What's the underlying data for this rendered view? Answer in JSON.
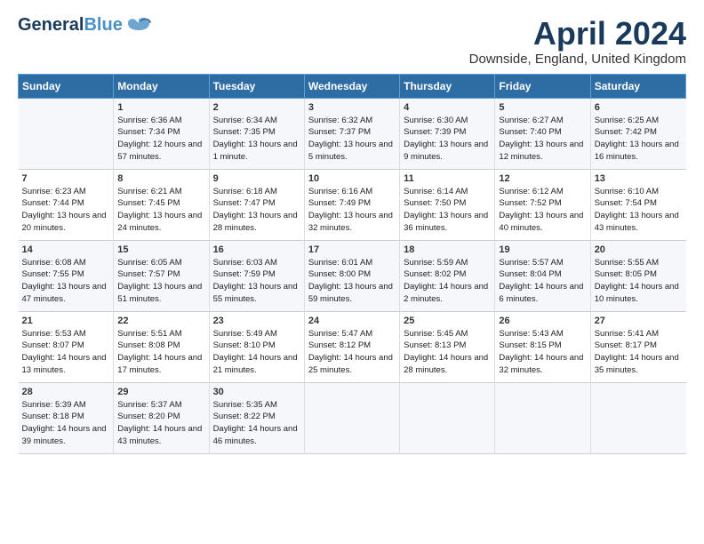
{
  "header": {
    "logo_general": "General",
    "logo_blue": "Blue",
    "title": "April 2024",
    "subtitle": "Downside, England, United Kingdom"
  },
  "columns": [
    "Sunday",
    "Monday",
    "Tuesday",
    "Wednesday",
    "Thursday",
    "Friday",
    "Saturday"
  ],
  "weeks": [
    [
      {
        "day": "",
        "sunrise": "",
        "sunset": "",
        "daylight": ""
      },
      {
        "day": "1",
        "sunrise": "Sunrise: 6:36 AM",
        "sunset": "Sunset: 7:34 PM",
        "daylight": "Daylight: 12 hours and 57 minutes."
      },
      {
        "day": "2",
        "sunrise": "Sunrise: 6:34 AM",
        "sunset": "Sunset: 7:35 PM",
        "daylight": "Daylight: 13 hours and 1 minute."
      },
      {
        "day": "3",
        "sunrise": "Sunrise: 6:32 AM",
        "sunset": "Sunset: 7:37 PM",
        "daylight": "Daylight: 13 hours and 5 minutes."
      },
      {
        "day": "4",
        "sunrise": "Sunrise: 6:30 AM",
        "sunset": "Sunset: 7:39 PM",
        "daylight": "Daylight: 13 hours and 9 minutes."
      },
      {
        "day": "5",
        "sunrise": "Sunrise: 6:27 AM",
        "sunset": "Sunset: 7:40 PM",
        "daylight": "Daylight: 13 hours and 12 minutes."
      },
      {
        "day": "6",
        "sunrise": "Sunrise: 6:25 AM",
        "sunset": "Sunset: 7:42 PM",
        "daylight": "Daylight: 13 hours and 16 minutes."
      }
    ],
    [
      {
        "day": "7",
        "sunrise": "Sunrise: 6:23 AM",
        "sunset": "Sunset: 7:44 PM",
        "daylight": "Daylight: 13 hours and 20 minutes."
      },
      {
        "day": "8",
        "sunrise": "Sunrise: 6:21 AM",
        "sunset": "Sunset: 7:45 PM",
        "daylight": "Daylight: 13 hours and 24 minutes."
      },
      {
        "day": "9",
        "sunrise": "Sunrise: 6:18 AM",
        "sunset": "Sunset: 7:47 PM",
        "daylight": "Daylight: 13 hours and 28 minutes."
      },
      {
        "day": "10",
        "sunrise": "Sunrise: 6:16 AM",
        "sunset": "Sunset: 7:49 PM",
        "daylight": "Daylight: 13 hours and 32 minutes."
      },
      {
        "day": "11",
        "sunrise": "Sunrise: 6:14 AM",
        "sunset": "Sunset: 7:50 PM",
        "daylight": "Daylight: 13 hours and 36 minutes."
      },
      {
        "day": "12",
        "sunrise": "Sunrise: 6:12 AM",
        "sunset": "Sunset: 7:52 PM",
        "daylight": "Daylight: 13 hours and 40 minutes."
      },
      {
        "day": "13",
        "sunrise": "Sunrise: 6:10 AM",
        "sunset": "Sunset: 7:54 PM",
        "daylight": "Daylight: 13 hours and 43 minutes."
      }
    ],
    [
      {
        "day": "14",
        "sunrise": "Sunrise: 6:08 AM",
        "sunset": "Sunset: 7:55 PM",
        "daylight": "Daylight: 13 hours and 47 minutes."
      },
      {
        "day": "15",
        "sunrise": "Sunrise: 6:05 AM",
        "sunset": "Sunset: 7:57 PM",
        "daylight": "Daylight: 13 hours and 51 minutes."
      },
      {
        "day": "16",
        "sunrise": "Sunrise: 6:03 AM",
        "sunset": "Sunset: 7:59 PM",
        "daylight": "Daylight: 13 hours and 55 minutes."
      },
      {
        "day": "17",
        "sunrise": "Sunrise: 6:01 AM",
        "sunset": "Sunset: 8:00 PM",
        "daylight": "Daylight: 13 hours and 59 minutes."
      },
      {
        "day": "18",
        "sunrise": "Sunrise: 5:59 AM",
        "sunset": "Sunset: 8:02 PM",
        "daylight": "Daylight: 14 hours and 2 minutes."
      },
      {
        "day": "19",
        "sunrise": "Sunrise: 5:57 AM",
        "sunset": "Sunset: 8:04 PM",
        "daylight": "Daylight: 14 hours and 6 minutes."
      },
      {
        "day": "20",
        "sunrise": "Sunrise: 5:55 AM",
        "sunset": "Sunset: 8:05 PM",
        "daylight": "Daylight: 14 hours and 10 minutes."
      }
    ],
    [
      {
        "day": "21",
        "sunrise": "Sunrise: 5:53 AM",
        "sunset": "Sunset: 8:07 PM",
        "daylight": "Daylight: 14 hours and 13 minutes."
      },
      {
        "day": "22",
        "sunrise": "Sunrise: 5:51 AM",
        "sunset": "Sunset: 8:08 PM",
        "daylight": "Daylight: 14 hours and 17 minutes."
      },
      {
        "day": "23",
        "sunrise": "Sunrise: 5:49 AM",
        "sunset": "Sunset: 8:10 PM",
        "daylight": "Daylight: 14 hours and 21 minutes."
      },
      {
        "day": "24",
        "sunrise": "Sunrise: 5:47 AM",
        "sunset": "Sunset: 8:12 PM",
        "daylight": "Daylight: 14 hours and 25 minutes."
      },
      {
        "day": "25",
        "sunrise": "Sunrise: 5:45 AM",
        "sunset": "Sunset: 8:13 PM",
        "daylight": "Daylight: 14 hours and 28 minutes."
      },
      {
        "day": "26",
        "sunrise": "Sunrise: 5:43 AM",
        "sunset": "Sunset: 8:15 PM",
        "daylight": "Daylight: 14 hours and 32 minutes."
      },
      {
        "day": "27",
        "sunrise": "Sunrise: 5:41 AM",
        "sunset": "Sunset: 8:17 PM",
        "daylight": "Daylight: 14 hours and 35 minutes."
      }
    ],
    [
      {
        "day": "28",
        "sunrise": "Sunrise: 5:39 AM",
        "sunset": "Sunset: 8:18 PM",
        "daylight": "Daylight: 14 hours and 39 minutes."
      },
      {
        "day": "29",
        "sunrise": "Sunrise: 5:37 AM",
        "sunset": "Sunset: 8:20 PM",
        "daylight": "Daylight: 14 hours and 43 minutes."
      },
      {
        "day": "30",
        "sunrise": "Sunrise: 5:35 AM",
        "sunset": "Sunset: 8:22 PM",
        "daylight": "Daylight: 14 hours and 46 minutes."
      },
      {
        "day": "",
        "sunrise": "",
        "sunset": "",
        "daylight": ""
      },
      {
        "day": "",
        "sunrise": "",
        "sunset": "",
        "daylight": ""
      },
      {
        "day": "",
        "sunrise": "",
        "sunset": "",
        "daylight": ""
      },
      {
        "day": "",
        "sunrise": "",
        "sunset": "",
        "daylight": ""
      }
    ]
  ]
}
